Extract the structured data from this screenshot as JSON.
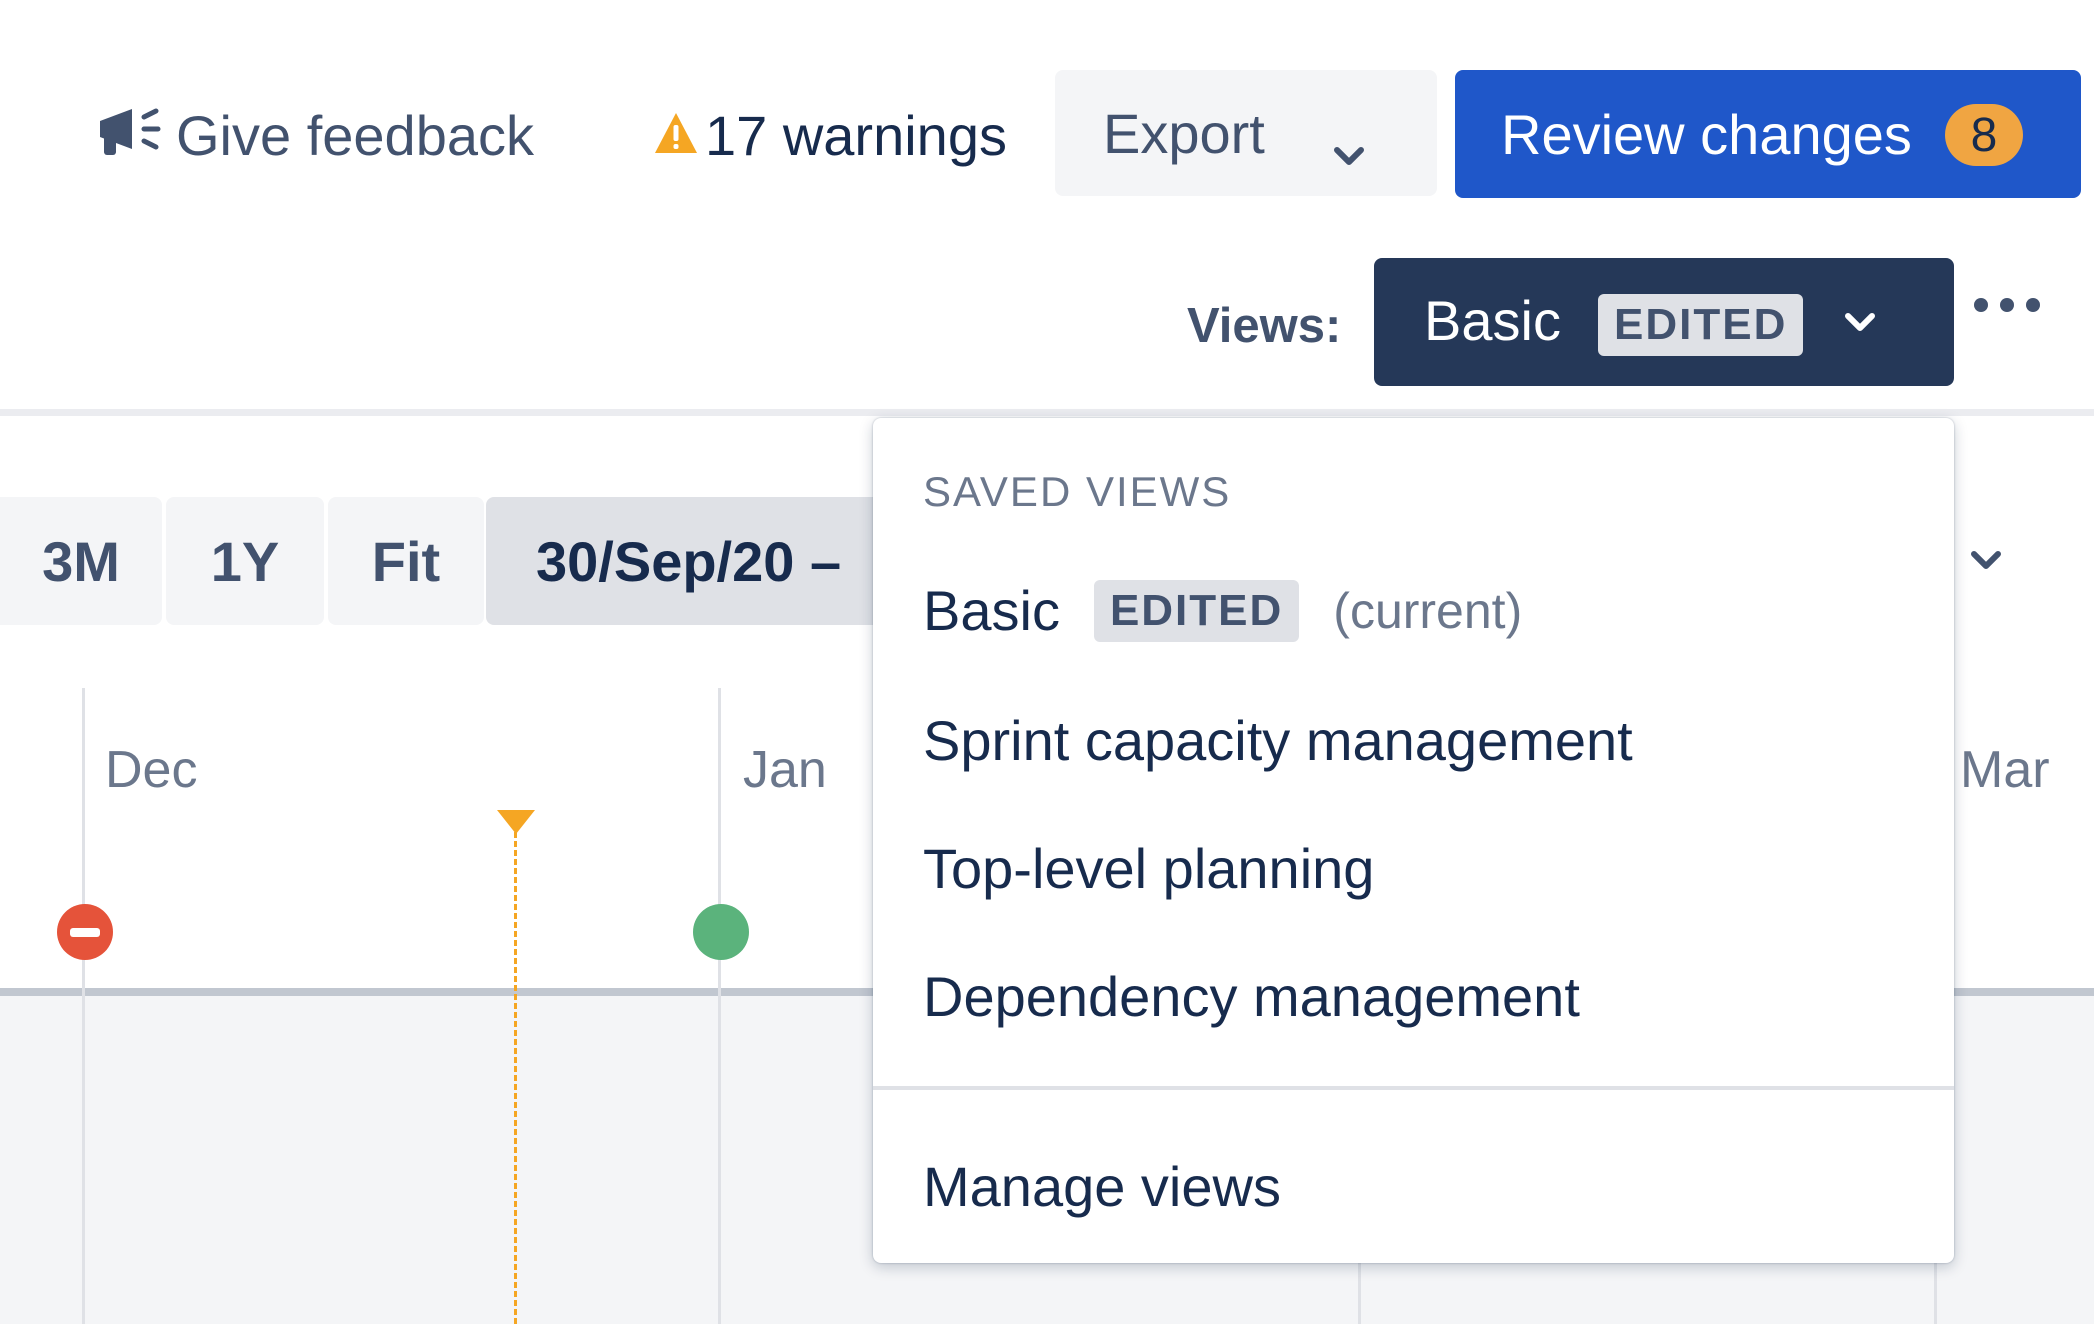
{
  "toolbar": {
    "feedback_label": "Give feedback",
    "warnings_label": "17 warnings",
    "export_label": "Export",
    "review_label": "Review changes",
    "review_count": "8"
  },
  "views": {
    "label": "Views:",
    "current_name": "Basic",
    "current_status": "EDITED"
  },
  "range": {
    "options": [
      "3M",
      "1Y",
      "Fit"
    ],
    "selected_range": "30/Sep/20 –"
  },
  "timeline": {
    "months": [
      "Dec",
      "Jan",
      "Mar"
    ]
  },
  "dropdown": {
    "heading": "SAVED VIEWS",
    "current_item": {
      "name": "Basic",
      "status": "EDITED",
      "note": "(current)"
    },
    "items": [
      "Sprint capacity management",
      "Top-level planning",
      "Dependency management"
    ],
    "manage_label": "Manage views"
  },
  "colors": {
    "primary": "#1F57C9",
    "views_button": "#253858",
    "badge": "#F0A542",
    "warning": "#F5A623",
    "release_red": "#E5533A",
    "release_green": "#5BB37C"
  }
}
